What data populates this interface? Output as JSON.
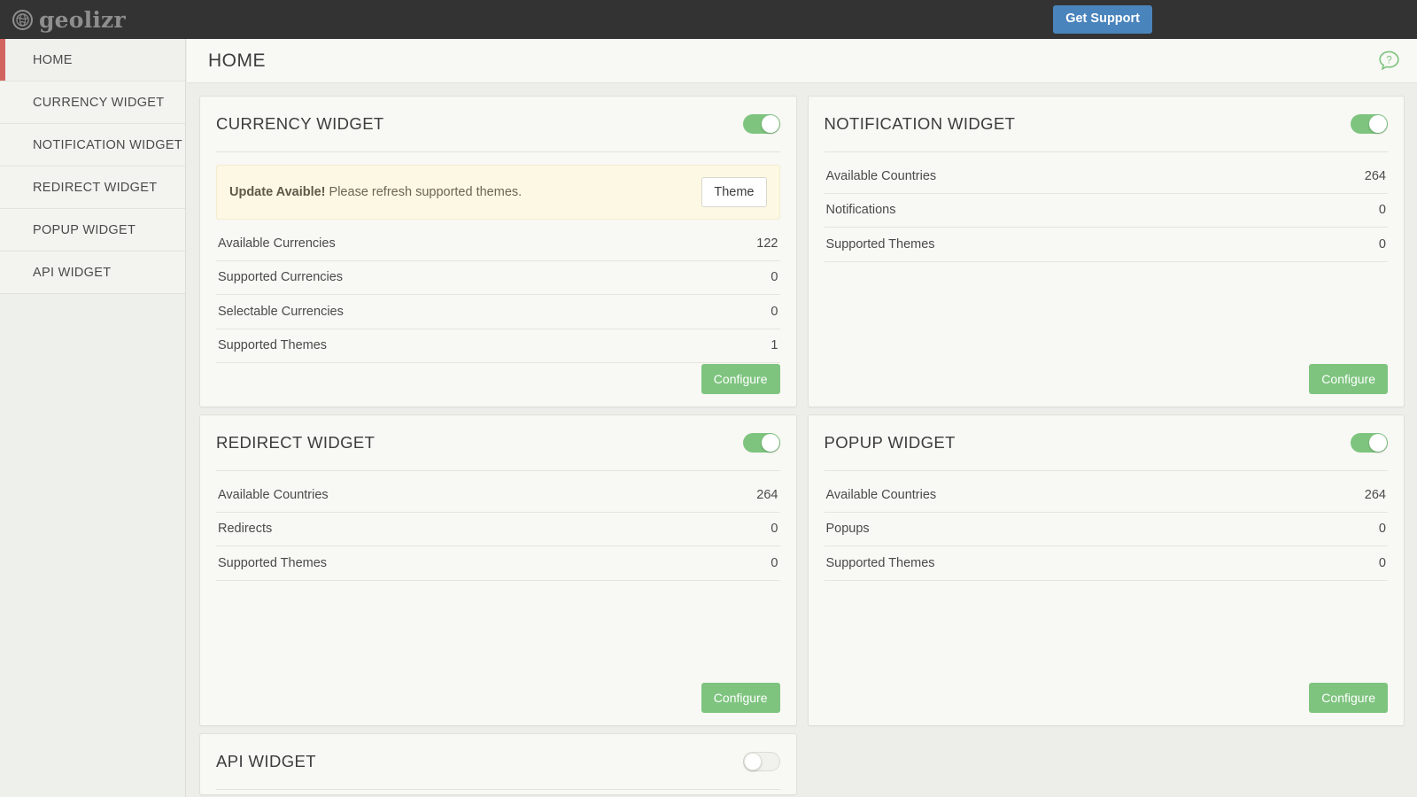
{
  "topbar": {
    "logo_text": "geolizr",
    "logo_icon": "globe-icon",
    "support_button": "Get Support",
    "support_color": "#4a84bd"
  },
  "sidebar": {
    "items": [
      {
        "label": "HOME",
        "active": true
      },
      {
        "label": "CURRENCY WIDGET",
        "active": false
      },
      {
        "label": "NOTIFICATION WIDGET",
        "active": false
      },
      {
        "label": "REDIRECT WIDGET",
        "active": false
      },
      {
        "label": "POPUP WIDGET",
        "active": false
      },
      {
        "label": "API WIDGET",
        "active": false
      }
    ],
    "active_indicator_color": "#d2645f"
  },
  "header": {
    "title": "HOME",
    "help_icon": "help-chat-icon",
    "help_color": "#7ec47f"
  },
  "cards": {
    "currency": {
      "title": "CURRENCY WIDGET",
      "toggle_state": "on",
      "alert": {
        "strong": "Update Avaible!",
        "text": " Please refresh supported themes.",
        "button": "Theme"
      },
      "stats": [
        {
          "label": "Available Currencies",
          "value": "122"
        },
        {
          "label": "Supported Currencies",
          "value": "0"
        },
        {
          "label": "Selectable Currencies",
          "value": "0"
        },
        {
          "label": "Supported Themes",
          "value": "1"
        }
      ],
      "configure": "Configure"
    },
    "notification": {
      "title": "NOTIFICATION WIDGET",
      "toggle_state": "on",
      "stats": [
        {
          "label": "Available Countries",
          "value": "264"
        },
        {
          "label": "Notifications",
          "value": "0"
        },
        {
          "label": "Supported Themes",
          "value": "0"
        }
      ],
      "configure": "Configure"
    },
    "redirect": {
      "title": "REDIRECT WIDGET",
      "toggle_state": "on",
      "stats": [
        {
          "label": "Available Countries",
          "value": "264"
        },
        {
          "label": "Redirects",
          "value": "0"
        },
        {
          "label": "Supported Themes",
          "value": "0"
        }
      ],
      "configure": "Configure"
    },
    "popup": {
      "title": "POPUP WIDGET",
      "toggle_state": "on",
      "stats": [
        {
          "label": "Available Countries",
          "value": "264"
        },
        {
          "label": "Popups",
          "value": "0"
        },
        {
          "label": "Supported Themes",
          "value": "0"
        }
      ],
      "configure": "Configure"
    },
    "api": {
      "title": "API WIDGET",
      "toggle_state": "off"
    }
  },
  "colors": {
    "accent_green": "#7ec47f",
    "alert_bg": "#fdf8e3",
    "topbar_bg": "#333333"
  }
}
